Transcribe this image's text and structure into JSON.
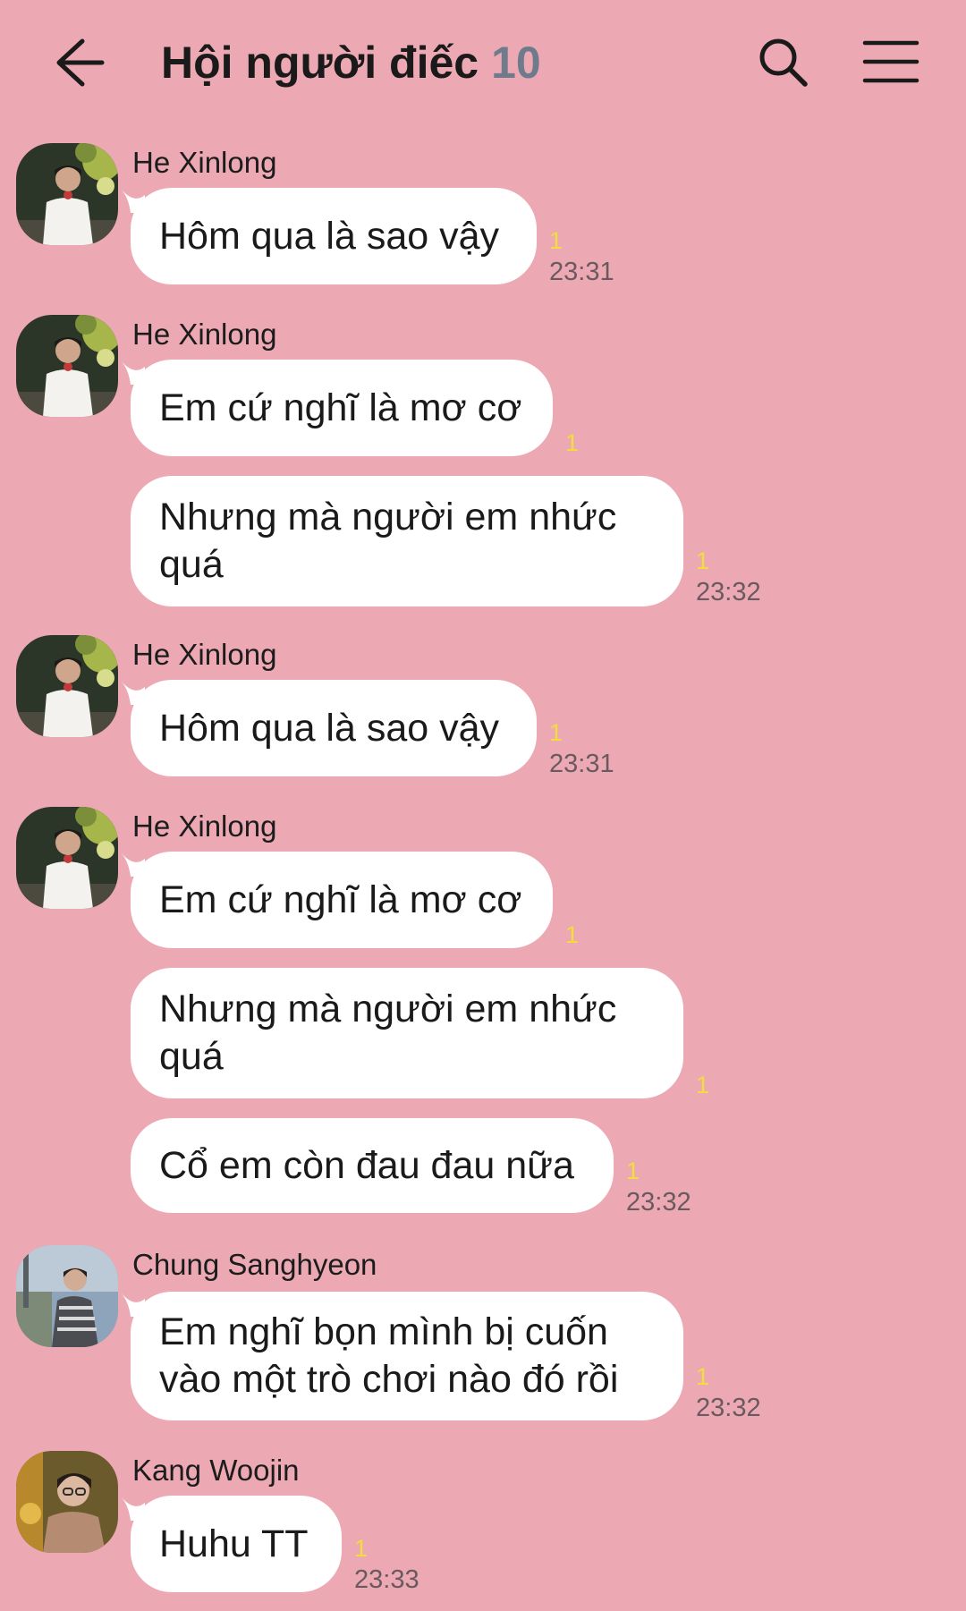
{
  "header": {
    "title": "Hội người điếc",
    "member_count": "10",
    "icons": [
      "back-arrow-icon",
      "search-icon",
      "menu-icon"
    ]
  },
  "messages": [
    {
      "sender": "He Xinlong",
      "text": "Hôm qua là sao vậy",
      "read": "1",
      "time": "23:31"
    },
    {
      "sender": "He Xinlong",
      "text": "Em cứ nghĩ là mơ cơ",
      "read": "1",
      "time": ""
    },
    {
      "sender": "",
      "text": "Nhưng mà người em nhức quá",
      "read": "1",
      "time": "23:32"
    },
    {
      "sender": "He Xinlong",
      "text": "Hôm qua là sao vậy",
      "read": "1",
      "time": "23:31"
    },
    {
      "sender": "He Xinlong",
      "text": "Em cứ nghĩ là mơ cơ",
      "read": "1",
      "time": ""
    },
    {
      "sender": "",
      "text": "Nhưng mà người em nhức quá",
      "read": "1",
      "time": ""
    },
    {
      "sender": "",
      "text": "Cổ em còn đau đau nữa",
      "read": "1",
      "time": "23:32"
    },
    {
      "sender": "Chung Sanghyeon",
      "text": "Em nghĩ bọn mình bị cuốn vào một trò chơi nào đó rồi",
      "read": "1",
      "time": "23:32"
    },
    {
      "sender": "Kang Woojin",
      "text": "Huhu TT",
      "read": "1",
      "time": "23:33"
    }
  ],
  "colors": {
    "background": "#eca9b3",
    "bubble": "#ffffff",
    "read_count": "#f1dd3c",
    "member_count": "#6f7b8c"
  }
}
